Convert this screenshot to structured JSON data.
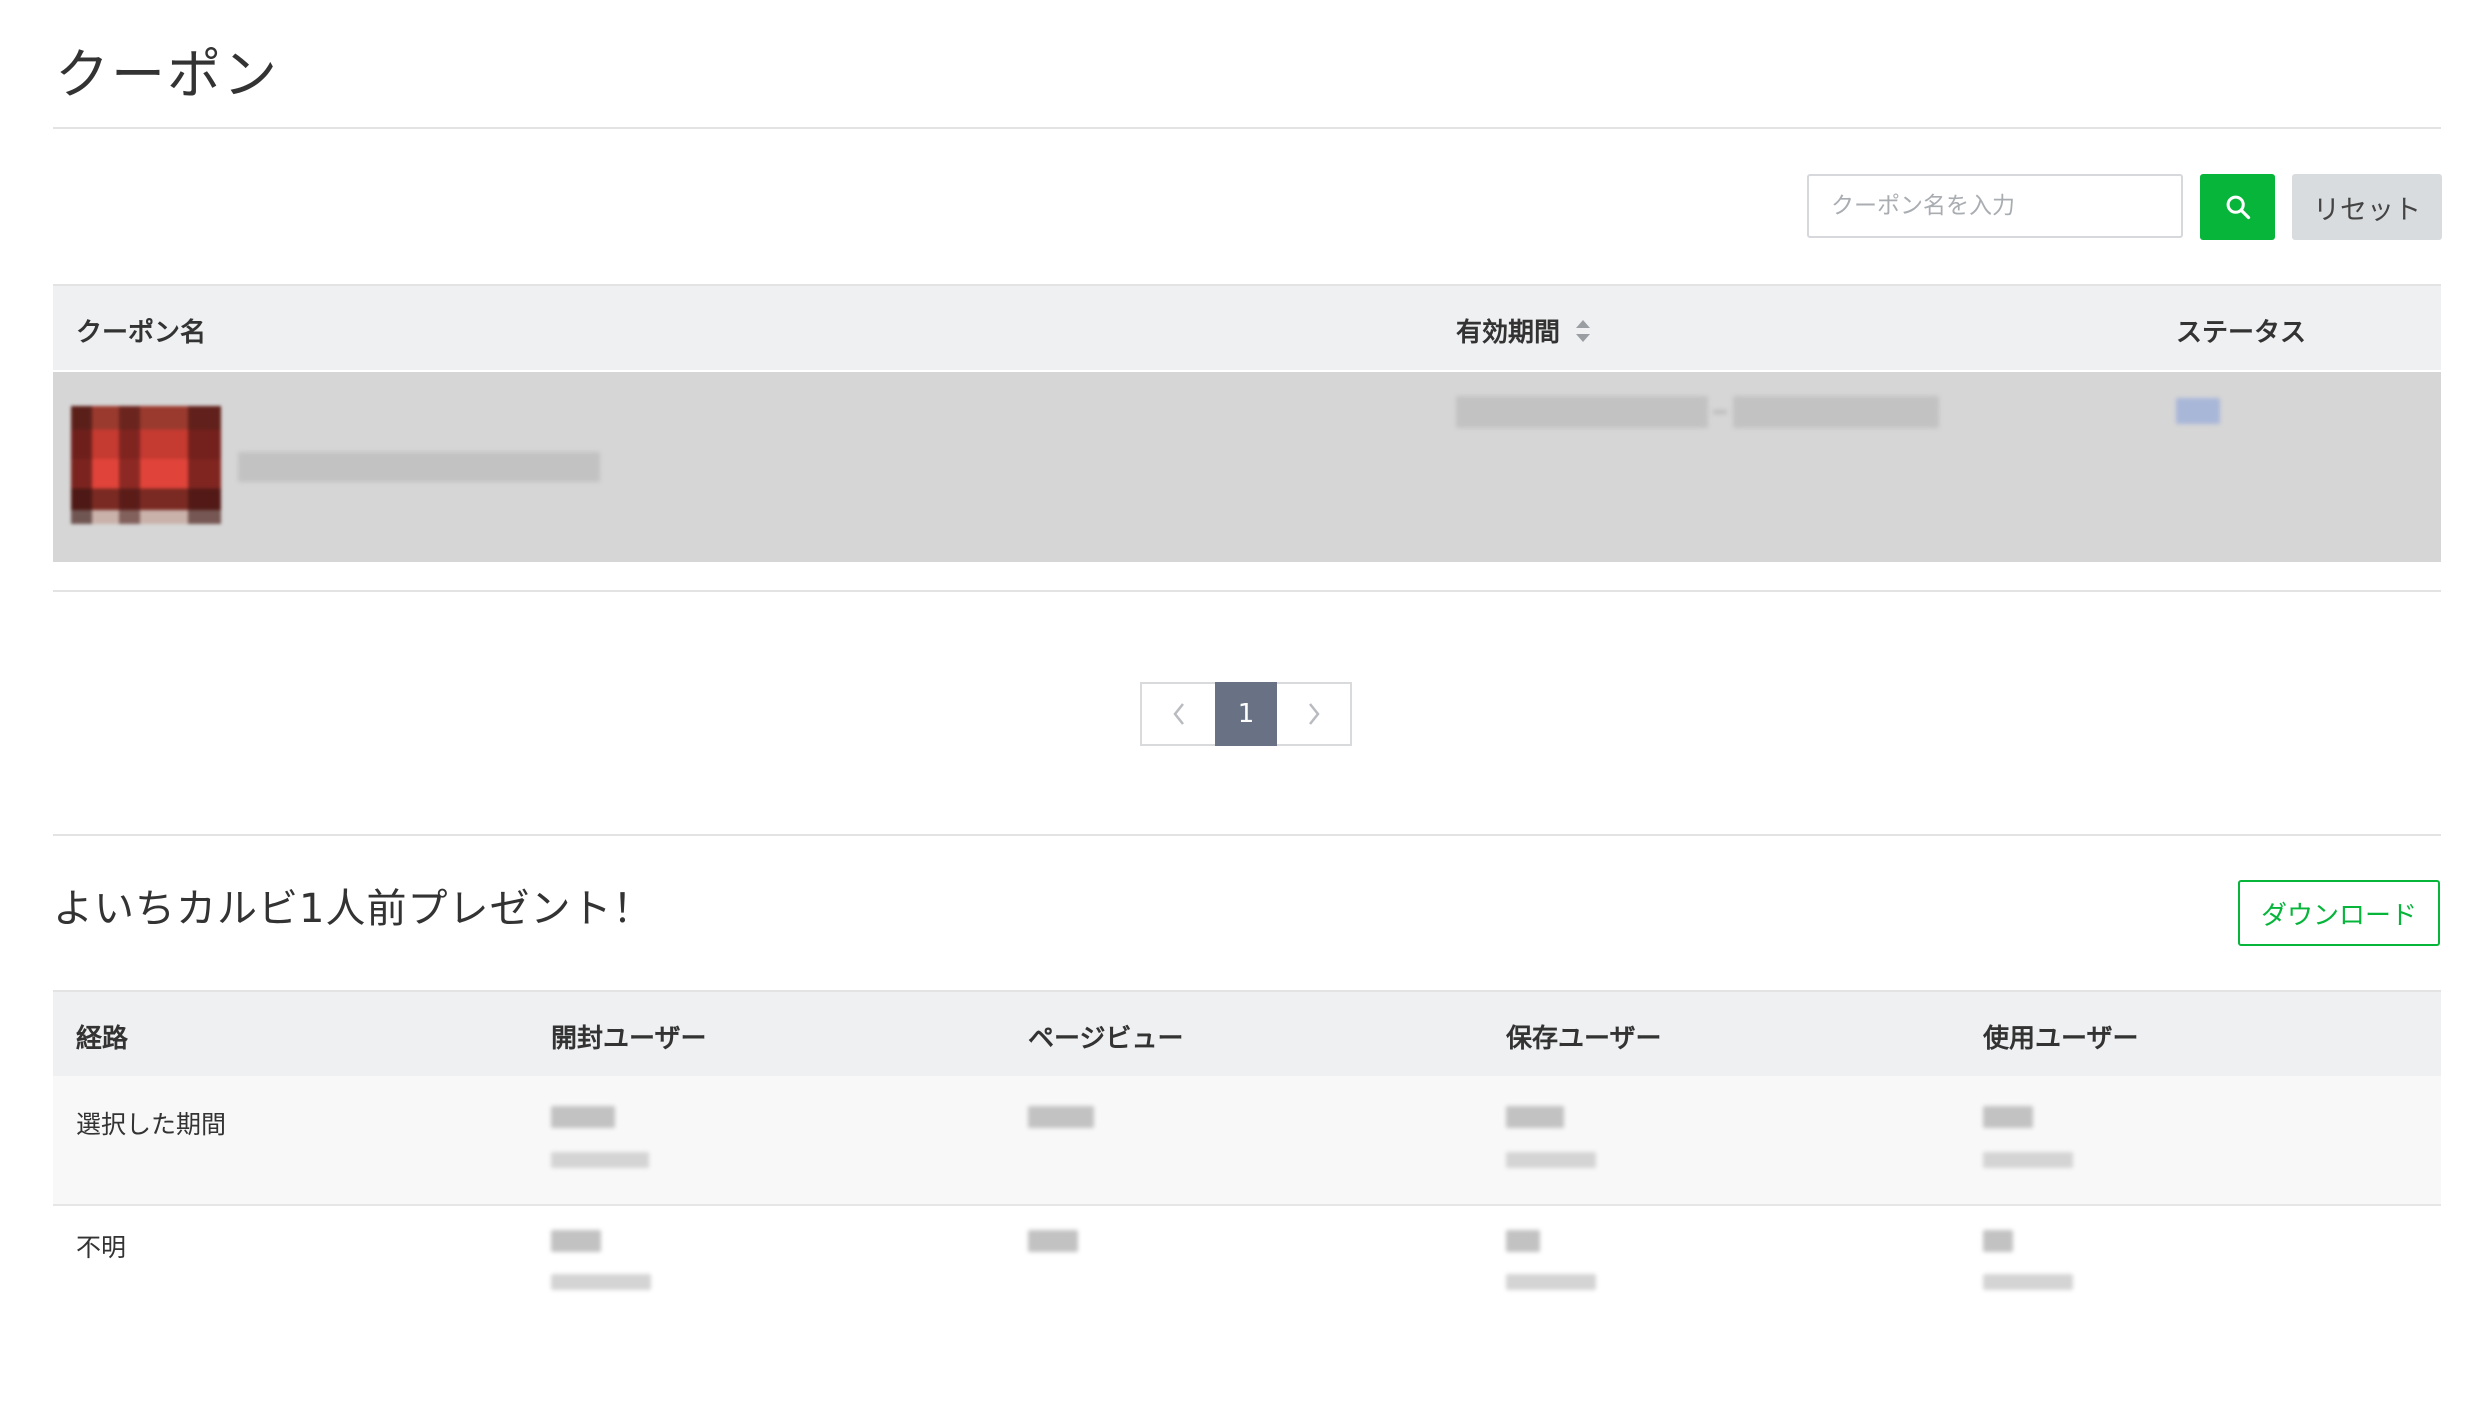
{
  "page": {
    "title": "クーポン"
  },
  "search": {
    "placeholder": "クーポン名を入力",
    "value": "",
    "reset_label": "リセット"
  },
  "coupon_table": {
    "columns": [
      "クーポン名",
      "有効期間",
      "ステータス"
    ],
    "sortable_column": "有効期間"
  },
  "pagination": {
    "prev": "‹",
    "current": "1",
    "next": "›"
  },
  "detail": {
    "title": "よいちカルビ1人前プレゼント！",
    "download_label": "ダウンロード",
    "columns": [
      "経路",
      "開封ユーザー",
      "ページビュー",
      "保存ユーザー",
      "使用ユーザー"
    ],
    "rows": [
      {
        "label": "選択した期間"
      },
      {
        "label": "不明"
      }
    ]
  },
  "colors": {
    "primary_green": "#07b53b",
    "pager_active": "#687284",
    "header_bg": "#eff0f2",
    "selected_row_bg": "#d6d6d6"
  },
  "icons": [
    "search-icon",
    "sort-icon",
    "chevron-left-icon",
    "chevron-right-icon"
  ]
}
